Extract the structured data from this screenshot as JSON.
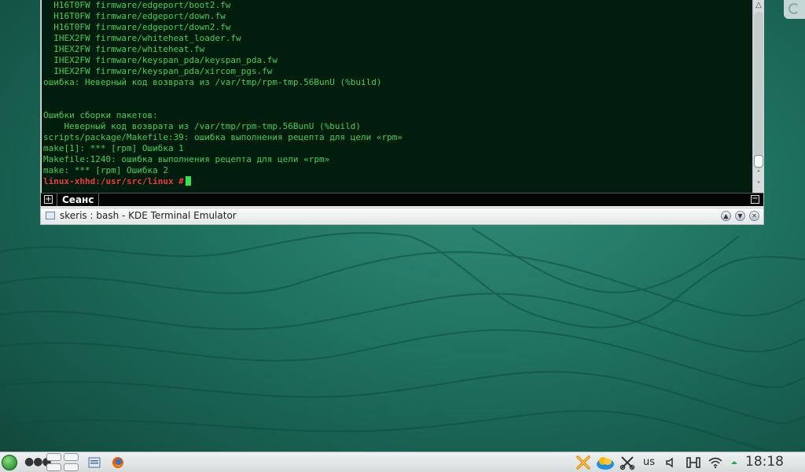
{
  "terminal": {
    "lines": [
      "  H16T0FW firmware/edgeport/boot2.fw",
      "  H16T0FW firmware/edgeport/down.fw",
      "  H16T0FW firmware/edgeport/down2.fw",
      "  IHEX2FW firmware/whiteheat_loader.fw",
      "  IHEX2FW firmware/whiteheat.fw",
      "  IHEX2FW firmware/keyspan_pda/keyspan_pda.fw",
      "  IHEX2FW firmware/keyspan_pda/xircom_pgs.fw",
      "ошибка: Неверный код возврата из /var/tmp/rpm-tmp.56BunU (%build)",
      "",
      "",
      "Ошибки сборки пакетов:",
      "    Неверный код возврата из /var/tmp/rpm-tmp.56BunU (%build)",
      "scripts/package/Makefile:39: ошибка выполнения рецепта для цели «rpm»",
      "make[1]: *** [rpm] Ошибка 1",
      "Makefile:1240: ошибка выполнения рецепта для цели «rpm»",
      "make: *** [rpm] Ошибка 2"
    ],
    "prompt": "linux-xhhd:/usr/src/linux #"
  },
  "tabbar": {
    "new_tab_glyph": "+",
    "tab_label": "Сеанс",
    "close_glyph": "−"
  },
  "window": {
    "title": "skeris : bash - KDE Terminal Emulator"
  },
  "taskbar": {
    "dots": "●●●",
    "keyboard_layout": "us",
    "clock": "18:18"
  },
  "colors": {
    "terminal_bg": "#011d0e",
    "terminal_fg": "#4ccb5a",
    "prompt": "#ef3b3b",
    "cursor": "#37e24b"
  }
}
